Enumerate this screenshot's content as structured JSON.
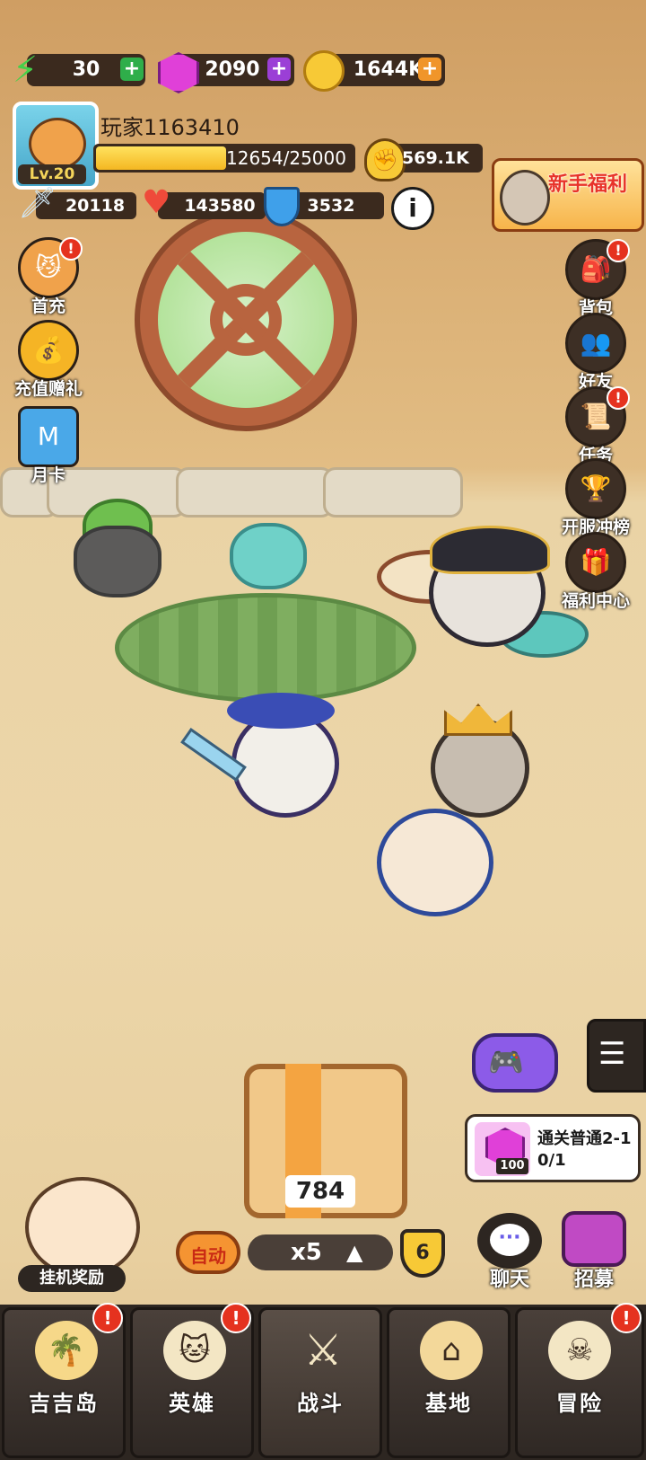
{
  "resources": {
    "energy": {
      "icon": "lightning-icon",
      "value": "30"
    },
    "gems": {
      "icon": "gem-icon",
      "value": "2090"
    },
    "coins": {
      "icon": "coin-icon",
      "value": "1644K"
    }
  },
  "player": {
    "name": "玩家1163410",
    "level": "Lv.20",
    "xp_text": "12654/25000",
    "xp_fraction": 0.506,
    "power": "569.1K"
  },
  "stats": {
    "attack": "20118",
    "hp": "143580",
    "defense": "3532"
  },
  "left_menu": [
    {
      "label": "首充",
      "icon": "first-recharge-icon",
      "badge": "!"
    },
    {
      "label": "充值赠礼",
      "icon": "money-bag-icon",
      "badge": ""
    },
    {
      "label": "月卡",
      "icon": "month-card-icon",
      "badge": ""
    }
  ],
  "right_menu": [
    {
      "label": "背包",
      "icon": "backpack-icon",
      "badge": "!"
    },
    {
      "label": "好友",
      "icon": "friends-icon",
      "badge": ""
    },
    {
      "label": "任务",
      "icon": "task-icon",
      "badge": "!"
    },
    {
      "label": "开服冲榜",
      "icon": "trophy-icon",
      "badge": ""
    },
    {
      "label": "福利中心",
      "icon": "gift-icon",
      "badge": ""
    }
  ],
  "newbie_banner": {
    "label": "新手福利"
  },
  "chest": {
    "count": "784"
  },
  "controls": {
    "auto_label": "自动",
    "multiplier": "x5",
    "level_badge": "6",
    "idle_reward_label": "挂机奖励"
  },
  "quest": {
    "title": "通关普通2-1",
    "progress": "0/1",
    "reward_amount": "100"
  },
  "right_actions": {
    "chat_label": "聊天",
    "recruit_label": "招募"
  },
  "nav": [
    {
      "label": "吉吉岛",
      "icon": "palm-island-icon",
      "badge": "!"
    },
    {
      "label": "英雄",
      "icon": "hero-icon",
      "badge": "!"
    },
    {
      "label": "战斗",
      "icon": "crossed-swords-icon",
      "badge": ""
    },
    {
      "label": "基地",
      "icon": "base-icon",
      "badge": ""
    },
    {
      "label": "冒险",
      "icon": "adventure-skull-icon",
      "badge": "!"
    }
  ],
  "colors": {
    "energy_plus": "#2fae4a",
    "gem_plus": "#9b3fd6",
    "coin_plus": "#f0952a",
    "badge_red": "#e5321f"
  }
}
